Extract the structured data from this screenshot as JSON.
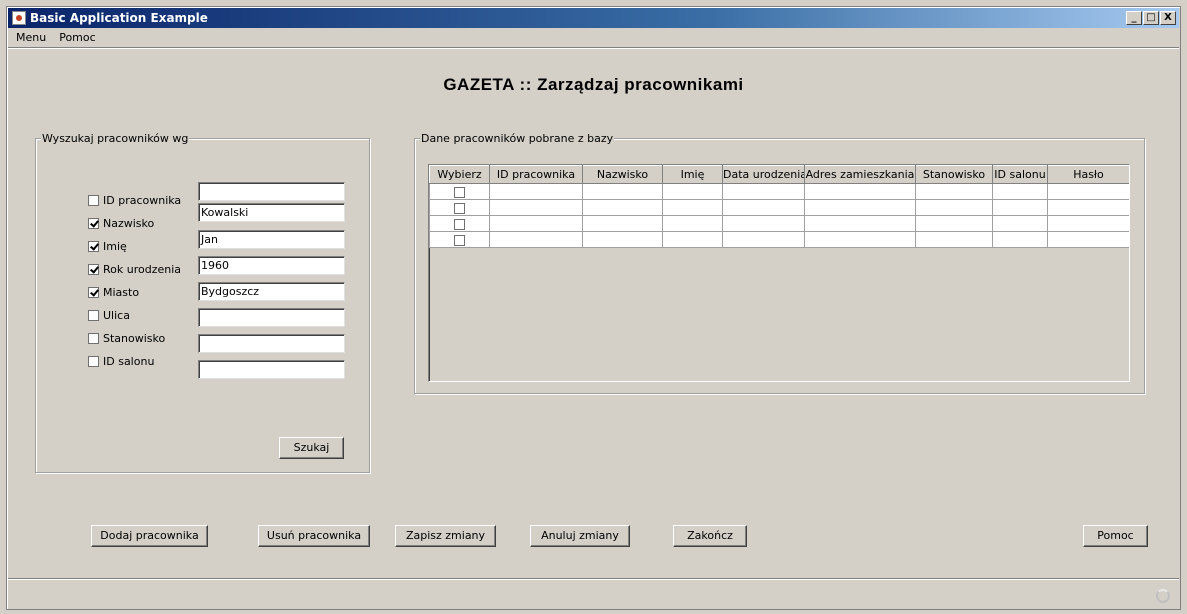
{
  "window": {
    "title": "Basic Application Example",
    "minimize_glyph": "_",
    "maximize_glyph": "□",
    "close_glyph": "X"
  },
  "menu": {
    "items": [
      "Menu",
      "Pomoc"
    ]
  },
  "heading": "GAZETA :: Zarządzaj pracownikami",
  "search_panel": {
    "legend": "Wyszukaj pracowników wg",
    "criteria": [
      {
        "label": "ID pracownika",
        "checked": false,
        "value": ""
      },
      {
        "label": "Nazwisko",
        "checked": true,
        "value": "Kowalski"
      },
      {
        "label": "Imię",
        "checked": true,
        "value": "Jan"
      },
      {
        "label": "Rok urodzenia",
        "checked": true,
        "value": "1960"
      },
      {
        "label": "Miasto",
        "checked": true,
        "value": "Bydgoszcz"
      },
      {
        "label": "Ulica",
        "checked": false,
        "value": ""
      },
      {
        "label": "Stanowisko",
        "checked": false,
        "value": ""
      },
      {
        "label": "ID salonu",
        "checked": false,
        "value": ""
      }
    ],
    "search_button": "Szukaj"
  },
  "results_panel": {
    "legend": "Dane pracowników pobrane z bazy",
    "columns": [
      "Wybierz",
      "ID pracownika",
      "Nazwisko",
      "Imię",
      "Data urodzenia",
      "Adres zamieszkania",
      "Stanowisko",
      "ID salonu",
      "Hasło"
    ],
    "rows": [
      {
        "selected": false,
        "cells": [
          "",
          "",
          "",
          "",
          "",
          "",
          "",
          ""
        ]
      },
      {
        "selected": false,
        "cells": [
          "",
          "",
          "",
          "",
          "",
          "",
          "",
          ""
        ]
      },
      {
        "selected": false,
        "cells": [
          "",
          "",
          "",
          "",
          "",
          "",
          "",
          ""
        ]
      },
      {
        "selected": false,
        "cells": [
          "",
          "",
          "",
          "",
          "",
          "",
          "",
          ""
        ]
      }
    ]
  },
  "actions": {
    "add": "Dodaj pracownika",
    "remove": "Usuń pracownika",
    "save": "Zapisz zmiany",
    "cancel": "Anuluj zmiany",
    "exit": "Zakończ",
    "help": "Pomoc"
  },
  "icons": {
    "app": "java-cup-icon",
    "status": "busy-spinner-icon"
  }
}
